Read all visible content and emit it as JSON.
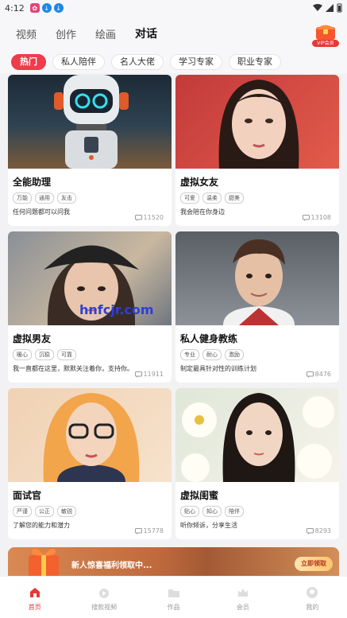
{
  "status": {
    "time": "4:12",
    "app_icon": "pink-app-icon",
    "download_icon": "download-icon"
  },
  "top_tabs": [
    "视频",
    "创作",
    "绘画",
    "对话"
  ],
  "active_top_tab": "对话",
  "vip": {
    "label": "VIP会员",
    "icon": "treasure-chest-icon"
  },
  "filters": [
    "热门",
    "私人陪伴",
    "名人大佬",
    "学习专家",
    "职业专家"
  ],
  "active_filter": "热门",
  "cards": [
    {
      "title": "全能助理",
      "tags": [
        "万能",
        "通用",
        "友击"
      ],
      "desc": "任何问题都可以问我",
      "count": "11520",
      "image": "robot-illustration"
    },
    {
      "title": "虚拟女友",
      "tags": [
        "可爱",
        "温柔",
        "甜美"
      ],
      "desc": "我会陪在你身边",
      "count": "13108",
      "image": "girl-portrait-red-background"
    },
    {
      "title": "虚拟男友",
      "tags": [
        "暖心",
        "沉稳",
        "可靠"
      ],
      "desc": "我一直都在这里，默默关注着你，支持你。",
      "count": "11911",
      "image": "boy-in-cap-portrait"
    },
    {
      "title": "私人健身教练",
      "tags": [
        "专业",
        "耐心",
        "激励"
      ],
      "desc": "制定最具针对性的训练计划",
      "count": "8476",
      "image": "young-man-portrait"
    },
    {
      "title": "面试官",
      "tags": [
        "严谨",
        "公正",
        "敏锐"
      ],
      "desc": "了解您的能力和潜力",
      "count": "15778",
      "image": "woman-with-glasses-portrait"
    },
    {
      "title": "虚拟闺蜜",
      "tags": [
        "贴心",
        "知心",
        "陪伴"
      ],
      "desc": "听你倾诉，分享生活",
      "count": "8293",
      "image": "woman-with-flowers-portrait"
    }
  ],
  "banner": {
    "text": "新人惊喜福利领取中...",
    "button": "立即领取"
  },
  "watermark": "hnfcjr.com",
  "bottom_nav": [
    {
      "label": "首页",
      "icon": "home-icon"
    },
    {
      "label": "搜款视频",
      "icon": "video-icon"
    },
    {
      "label": "作品",
      "icon": "folder-icon"
    },
    {
      "label": "会员",
      "icon": "crown-icon"
    },
    {
      "label": "我的",
      "icon": "profile-icon"
    }
  ],
  "active_nav": "首页",
  "colors": {
    "accent": "#ef3b4a",
    "banner": "#c06a3d",
    "tab_underline": "#f2b8be"
  }
}
